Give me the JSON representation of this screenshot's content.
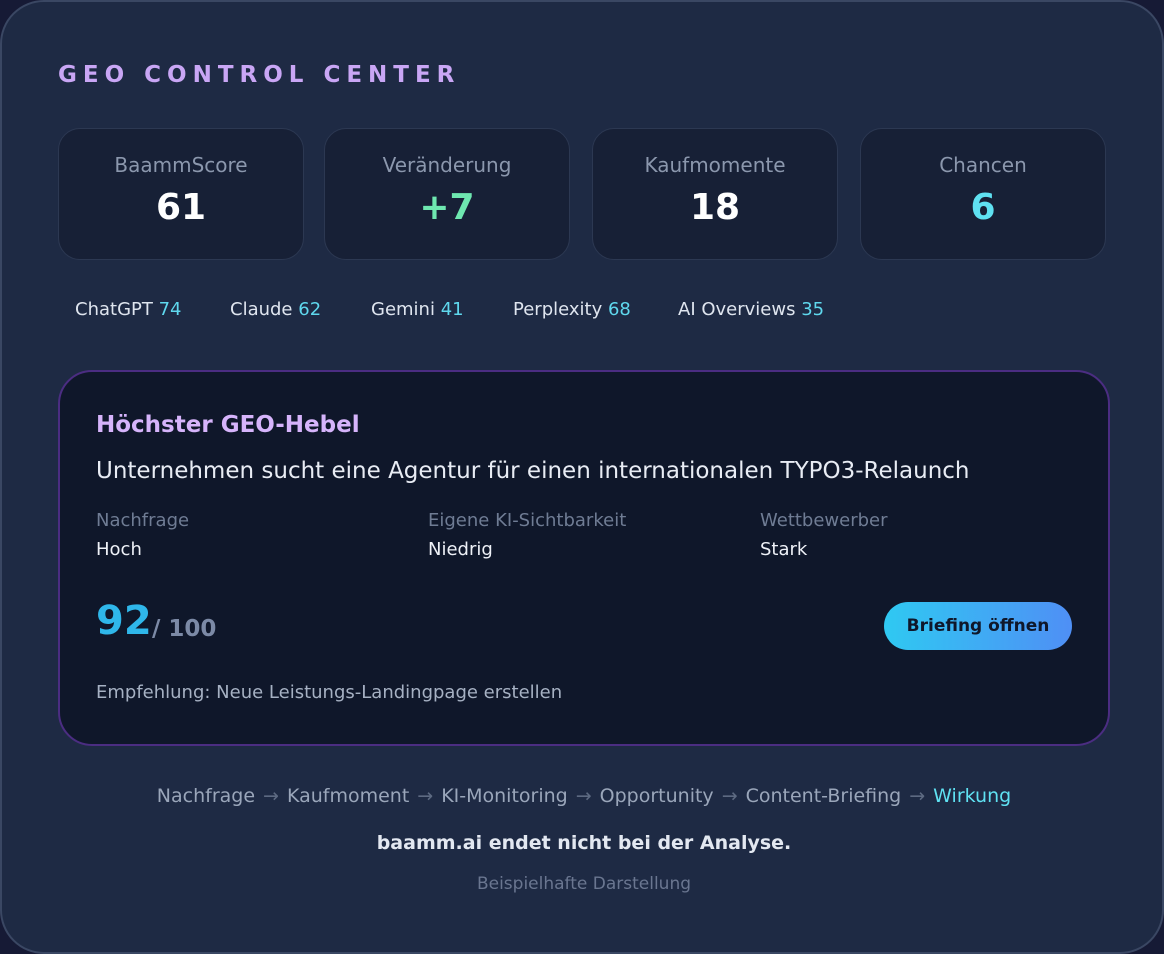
{
  "title": "GEO CONTROL CENTER",
  "stats": [
    {
      "label": "BaammScore",
      "value": "61"
    },
    {
      "label": "Veränderung",
      "value": "+7"
    },
    {
      "label": "Kaufmomente",
      "value": "18"
    },
    {
      "label": "Chancen",
      "value": "6"
    }
  ],
  "models": [
    {
      "name": "ChatGPT",
      "score": "74"
    },
    {
      "name": "Claude",
      "score": "62"
    },
    {
      "name": "Gemini",
      "score": "41"
    },
    {
      "name": "Perplexity",
      "score": "68"
    },
    {
      "name": "AI Overviews",
      "score": "35"
    }
  ],
  "lever": {
    "title": "Höchster GEO-Hebel",
    "subtitle": "Unternehmen sucht eine Agentur für einen internationalen TYPO3-Relaunch",
    "metrics": [
      {
        "label": "Nachfrage",
        "value": "Hoch"
      },
      {
        "label": "Eigene KI-Sichtbarkeit",
        "value": "Niedrig"
      },
      {
        "label": "Wettbewerber",
        "value": "Stark"
      }
    ],
    "score": "92",
    "score_max": "/ 100",
    "button_label": "Briefing öffnen",
    "recommendation": "Empfehlung: Neue Leistungs-Landingpage erstellen"
  },
  "flow": {
    "steps": [
      "Nachfrage",
      "Kaufmoment",
      "KI-Monitoring",
      "Opportunity",
      "Content-Briefing",
      "Wirkung"
    ],
    "arrow": "→"
  },
  "tagline": "baamm.ai endet nicht bei der Analyse.",
  "footnote": "Beispielhafte Darstellung",
  "colors": {
    "accent_purple": "#c9a6f5",
    "accent_cyan": "#5fe1f2",
    "accent_green": "#6ee7b0",
    "score_blue": "#2fb7ea"
  }
}
